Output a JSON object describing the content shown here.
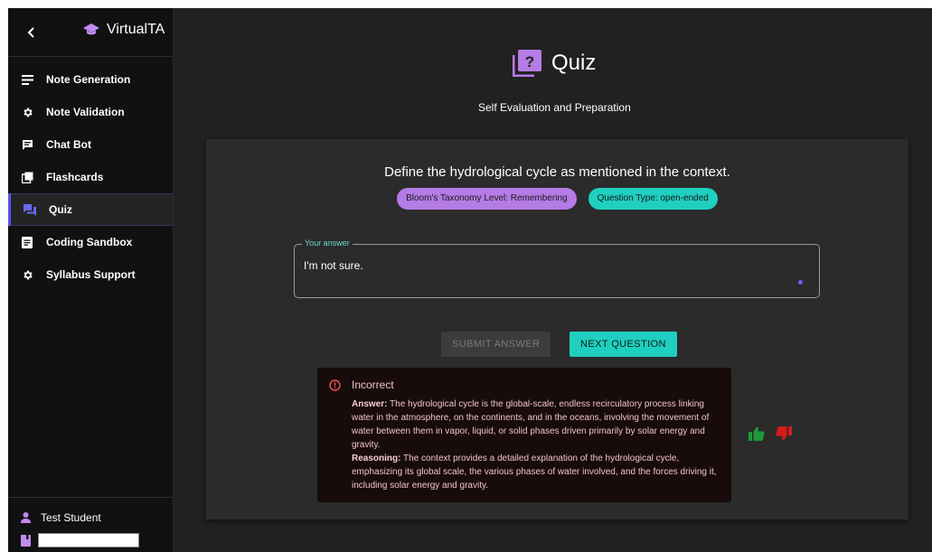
{
  "sidebar": {
    "brand": "VirtualTA",
    "items": [
      {
        "label": "Note Generation"
      },
      {
        "label": "Note Validation"
      },
      {
        "label": "Chat Bot"
      },
      {
        "label": "Flashcards"
      },
      {
        "label": "Quiz"
      },
      {
        "label": "Coding Sandbox"
      },
      {
        "label": "Syllabus Support"
      }
    ],
    "active_item": "Quiz",
    "user_name": "Test Student",
    "notebook_value": ""
  },
  "header": {
    "title": "Quiz",
    "subtitle": "Self Evaluation and Preparation"
  },
  "quiz": {
    "question": "Define the hydrological cycle as mentioned in the context.",
    "bloom_chip": "Bloom's Taxonomy Level: Remembering",
    "type_chip": "Question Type: open-ended",
    "answer_label": "Your answer",
    "answer_value": "I'm not sure.",
    "submit_label": "SUBMIT ANSWER",
    "next_label": "NEXT QUESTION"
  },
  "result": {
    "status": "Incorrect",
    "answer_label": "Answer:",
    "answer_text": " The hydrological cycle is the global-scale, endless recirculatory process linking water in the atmosphere, on the continents, and in the oceans, involving the movement of water between them in vapor, liquid, or solid phases driven primarily by solar energy and gravity.",
    "reasoning_label": "Reasoning:",
    "reasoning_text": " The context provides a detailed explanation of the hydrological cycle, emphasizing its global scale, the various phases of water involved, and the forces driving it, including solar energy and gravity."
  },
  "colors": {
    "accent_teal": "#1fcfbf",
    "accent_purple": "#b57be6",
    "active_indicator": "#5b55e6",
    "thumb_up": "#1f9a3a",
    "thumb_down": "#d81b1b",
    "error_text": "#f2c4c4"
  },
  "icons": {
    "back": "chevron-left-icon",
    "brand": "graduation-cap-icon",
    "nav": [
      "list-icon",
      "gear-icon",
      "chat-icon",
      "flashcards-icon",
      "forum-icon",
      "document-icon",
      "gear-icon"
    ],
    "title": "quiz-icon",
    "error": "error-circle-icon",
    "user": "person-icon",
    "notebook": "notebook-icon",
    "feedback": [
      "thumb-up-icon",
      "thumb-down-icon"
    ]
  }
}
